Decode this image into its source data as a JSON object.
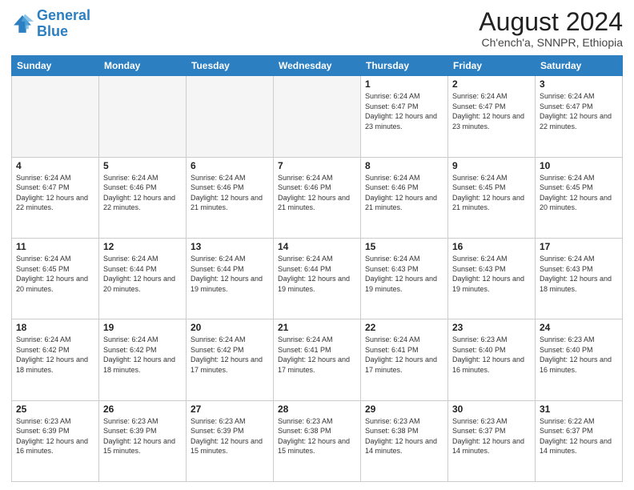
{
  "logo": {
    "line1": "General",
    "line2": "Blue"
  },
  "title": "August 2024",
  "subtitle": "Ch'ench'a, SNNPR, Ethiopia",
  "days_of_week": [
    "Sunday",
    "Monday",
    "Tuesday",
    "Wednesday",
    "Thursday",
    "Friday",
    "Saturday"
  ],
  "weeks": [
    [
      {
        "day": "",
        "info": ""
      },
      {
        "day": "",
        "info": ""
      },
      {
        "day": "",
        "info": ""
      },
      {
        "day": "",
        "info": ""
      },
      {
        "day": "1",
        "info": "Sunrise: 6:24 AM\nSunset: 6:47 PM\nDaylight: 12 hours\nand 23 minutes."
      },
      {
        "day": "2",
        "info": "Sunrise: 6:24 AM\nSunset: 6:47 PM\nDaylight: 12 hours\nand 23 minutes."
      },
      {
        "day": "3",
        "info": "Sunrise: 6:24 AM\nSunset: 6:47 PM\nDaylight: 12 hours\nand 22 minutes."
      }
    ],
    [
      {
        "day": "4",
        "info": "Sunrise: 6:24 AM\nSunset: 6:47 PM\nDaylight: 12 hours\nand 22 minutes."
      },
      {
        "day": "5",
        "info": "Sunrise: 6:24 AM\nSunset: 6:46 PM\nDaylight: 12 hours\nand 22 minutes."
      },
      {
        "day": "6",
        "info": "Sunrise: 6:24 AM\nSunset: 6:46 PM\nDaylight: 12 hours\nand 21 minutes."
      },
      {
        "day": "7",
        "info": "Sunrise: 6:24 AM\nSunset: 6:46 PM\nDaylight: 12 hours\nand 21 minutes."
      },
      {
        "day": "8",
        "info": "Sunrise: 6:24 AM\nSunset: 6:46 PM\nDaylight: 12 hours\nand 21 minutes."
      },
      {
        "day": "9",
        "info": "Sunrise: 6:24 AM\nSunset: 6:45 PM\nDaylight: 12 hours\nand 21 minutes."
      },
      {
        "day": "10",
        "info": "Sunrise: 6:24 AM\nSunset: 6:45 PM\nDaylight: 12 hours\nand 20 minutes."
      }
    ],
    [
      {
        "day": "11",
        "info": "Sunrise: 6:24 AM\nSunset: 6:45 PM\nDaylight: 12 hours\nand 20 minutes."
      },
      {
        "day": "12",
        "info": "Sunrise: 6:24 AM\nSunset: 6:44 PM\nDaylight: 12 hours\nand 20 minutes."
      },
      {
        "day": "13",
        "info": "Sunrise: 6:24 AM\nSunset: 6:44 PM\nDaylight: 12 hours\nand 19 minutes."
      },
      {
        "day": "14",
        "info": "Sunrise: 6:24 AM\nSunset: 6:44 PM\nDaylight: 12 hours\nand 19 minutes."
      },
      {
        "day": "15",
        "info": "Sunrise: 6:24 AM\nSunset: 6:43 PM\nDaylight: 12 hours\nand 19 minutes."
      },
      {
        "day": "16",
        "info": "Sunrise: 6:24 AM\nSunset: 6:43 PM\nDaylight: 12 hours\nand 19 minutes."
      },
      {
        "day": "17",
        "info": "Sunrise: 6:24 AM\nSunset: 6:43 PM\nDaylight: 12 hours\nand 18 minutes."
      }
    ],
    [
      {
        "day": "18",
        "info": "Sunrise: 6:24 AM\nSunset: 6:42 PM\nDaylight: 12 hours\nand 18 minutes."
      },
      {
        "day": "19",
        "info": "Sunrise: 6:24 AM\nSunset: 6:42 PM\nDaylight: 12 hours\nand 18 minutes."
      },
      {
        "day": "20",
        "info": "Sunrise: 6:24 AM\nSunset: 6:42 PM\nDaylight: 12 hours\nand 17 minutes."
      },
      {
        "day": "21",
        "info": "Sunrise: 6:24 AM\nSunset: 6:41 PM\nDaylight: 12 hours\nand 17 minutes."
      },
      {
        "day": "22",
        "info": "Sunrise: 6:24 AM\nSunset: 6:41 PM\nDaylight: 12 hours\nand 17 minutes."
      },
      {
        "day": "23",
        "info": "Sunrise: 6:23 AM\nSunset: 6:40 PM\nDaylight: 12 hours\nand 16 minutes."
      },
      {
        "day": "24",
        "info": "Sunrise: 6:23 AM\nSunset: 6:40 PM\nDaylight: 12 hours\nand 16 minutes."
      }
    ],
    [
      {
        "day": "25",
        "info": "Sunrise: 6:23 AM\nSunset: 6:39 PM\nDaylight: 12 hours\nand 16 minutes."
      },
      {
        "day": "26",
        "info": "Sunrise: 6:23 AM\nSunset: 6:39 PM\nDaylight: 12 hours\nand 15 minutes."
      },
      {
        "day": "27",
        "info": "Sunrise: 6:23 AM\nSunset: 6:39 PM\nDaylight: 12 hours\nand 15 minutes."
      },
      {
        "day": "28",
        "info": "Sunrise: 6:23 AM\nSunset: 6:38 PM\nDaylight: 12 hours\nand 15 minutes."
      },
      {
        "day": "29",
        "info": "Sunrise: 6:23 AM\nSunset: 6:38 PM\nDaylight: 12 hours\nand 14 minutes."
      },
      {
        "day": "30",
        "info": "Sunrise: 6:23 AM\nSunset: 6:37 PM\nDaylight: 12 hours\nand 14 minutes."
      },
      {
        "day": "31",
        "info": "Sunrise: 6:22 AM\nSunset: 6:37 PM\nDaylight: 12 hours\nand 14 minutes."
      }
    ]
  ]
}
